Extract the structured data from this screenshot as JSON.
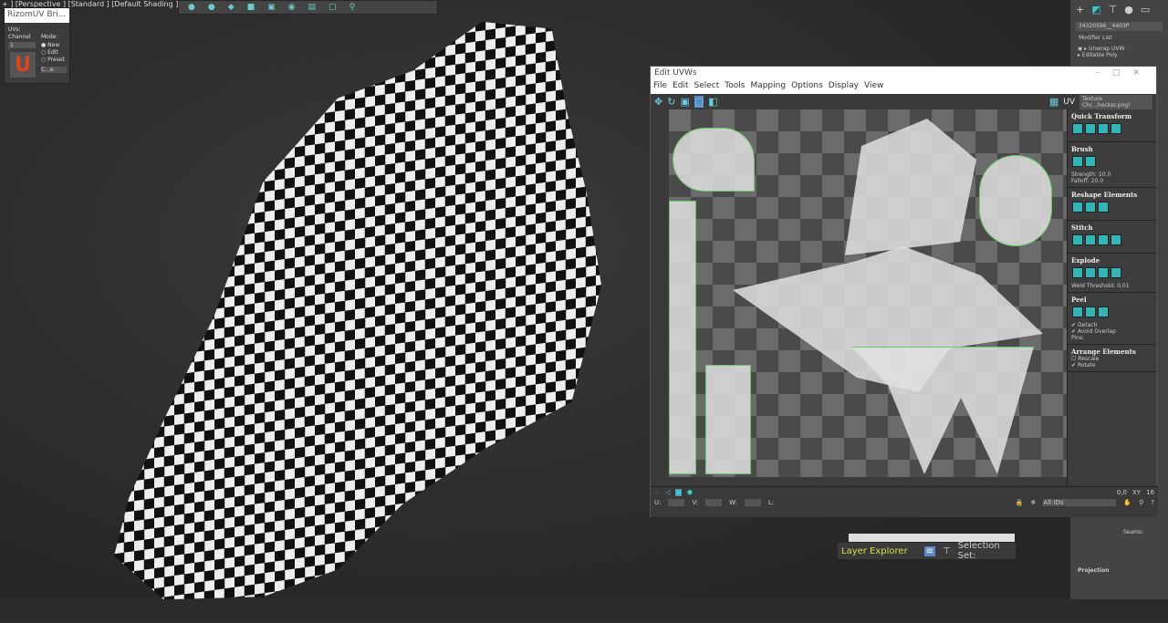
{
  "viewport": {
    "label": "+ ] [Perspective ] [Standard ] [Default Shading ]"
  },
  "rizom": {
    "title": "RizomUV Bri...",
    "uvs": "UVs:",
    "channel_label": "Channel",
    "channel": "1",
    "mode_label": "Mode:",
    "modes": [
      "New",
      "Edit",
      "Preset"
    ],
    "selected_mode": "New",
    "preset_select": "C...e"
  },
  "uv_editor": {
    "title": "Edit UVWs",
    "menu": [
      "File",
      "Edit",
      "Select",
      "Tools",
      "Mapping",
      "Options",
      "Display",
      "View"
    ],
    "uv_label": "UV",
    "texture": "Texture Chc...hecker.png)",
    "panel": {
      "quick_transform": "Quick Transform",
      "brush": "Brush",
      "strength_label": "Strength:",
      "strength": "10,0",
      "falloff_label": "Falloff:",
      "falloff": "20,0",
      "reshape": "Reshape Elements",
      "stitch": "Stitch",
      "explode": "Explode",
      "weld": "Weld",
      "threshold_label": "Threshold:",
      "threshold": "0,01",
      "peel": "Peel",
      "detach": "Detach",
      "avoid_overlap": "Avoid Overlap",
      "pins": "Pins:",
      "arrange": "Arrange Elements",
      "rescale": "Rescale",
      "rotate": "Rotate"
    },
    "bottom": {
      "angle": "0,0",
      "xy": "XY",
      "grid": "16",
      "u": "U:",
      "v": "V:",
      "w": "W:",
      "l": "L:",
      "ids": "All IDs"
    }
  },
  "command_panel": {
    "object_name": "34320596__4403P",
    "modifier_list": "Modifier List",
    "modifiers": [
      "Unwrap UVW",
      "Editable Poly"
    ],
    "seams": "Seams:",
    "projection": "Projection"
  },
  "layer_bar": {
    "label": "Layer Explorer",
    "selection_set": "Selection Set:"
  }
}
